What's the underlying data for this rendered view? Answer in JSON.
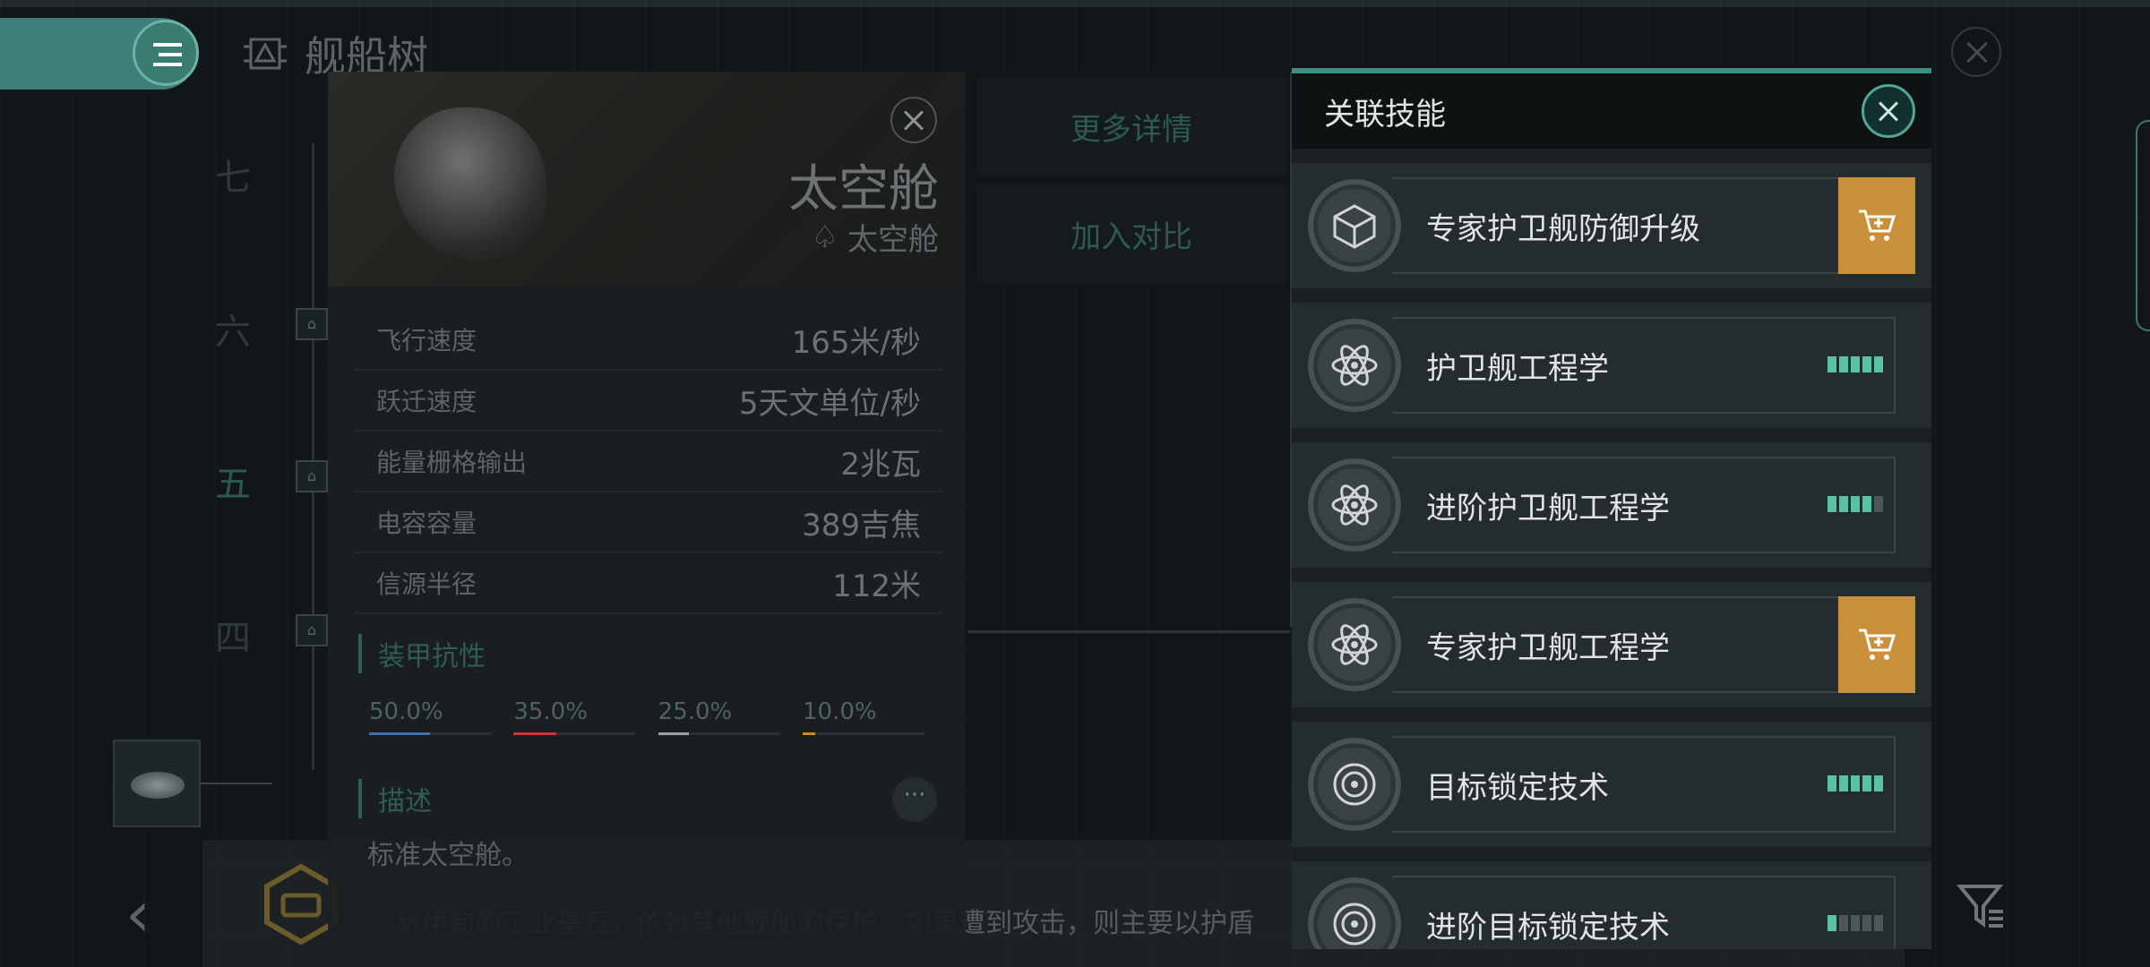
{
  "header": {
    "title": "舰船树"
  },
  "tiers": [
    "七",
    "六",
    "五",
    "四"
  ],
  "behind_buttons": {
    "details": "更多详情",
    "compare": "加入对比"
  },
  "ship": {
    "name": "太空舱",
    "class": "太空舱",
    "stats": [
      {
        "label": "飞行速度",
        "value": "165米/秒"
      },
      {
        "label": "跃迁速度",
        "value": "5天文单位/秒"
      },
      {
        "label": "能量栅格输出",
        "value": "2兆瓦"
      },
      {
        "label": "电容容量",
        "value": "389吉焦"
      },
      {
        "label": "信源半径",
        "value": "112米"
      }
    ],
    "armor_section": "装甲抗性",
    "resists": [
      {
        "value": "50.0%",
        "fraction": 0.5,
        "color": "#3d6fb3"
      },
      {
        "value": "35.0%",
        "fraction": 0.35,
        "color": "#c23c3c"
      },
      {
        "value": "25.0%",
        "fraction": 0.25,
        "color": "#9aa3a5"
      },
      {
        "value": "10.0%",
        "fraction": 0.1,
        "color": "#c88a2c"
      }
    ],
    "desc_section": "描述",
    "description": "标准太空舱。",
    "more": "···"
  },
  "bottom": {
    "back": "‹",
    "ticker": "新伊甸的工业基石。依赖其他舰船的保护。如果遭到攻击，则主要以护盾"
  },
  "skills_panel": {
    "title": "关联技能",
    "items": [
      {
        "name": "专家护卫舰防御升级",
        "icon": "cube-icon",
        "level": null,
        "cart": true
      },
      {
        "name": "护卫舰工程学",
        "icon": "atom-icon",
        "level": 5,
        "cart": false
      },
      {
        "name": "进阶护卫舰工程学",
        "icon": "atom-icon",
        "level": 4,
        "cart": false
      },
      {
        "name": "专家护卫舰工程学",
        "icon": "atom-icon",
        "level": null,
        "cart": true
      },
      {
        "name": "目标锁定技术",
        "icon": "target-icon",
        "level": 5,
        "cart": false
      },
      {
        "name": "进阶目标锁定技术",
        "icon": "target-icon",
        "level": 1,
        "cart": false
      }
    ]
  },
  "colors": {
    "accent": "#3d8f82",
    "cart": "#c98f3b",
    "level_on": "#57c3a6"
  }
}
